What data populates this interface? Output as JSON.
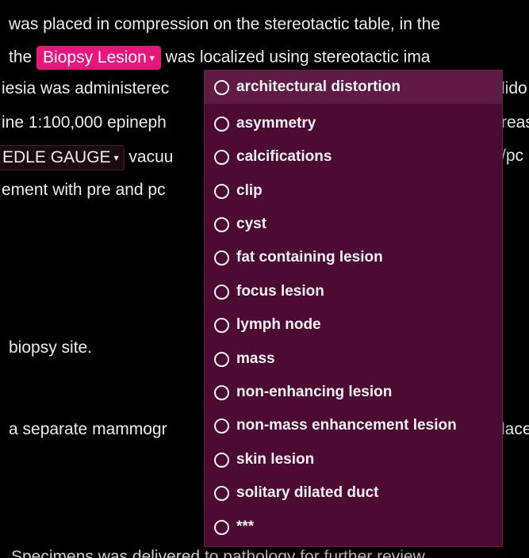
{
  "document": {
    "line1": "was placed in compression on the stereotactic table, in the",
    "line2_before": "the",
    "line2_dropdown": "Biopsy Lesion",
    "line2_after": "was localized using stereotactic ima",
    "line3": "iesia was administerec",
    "line3_right": "lido",
    "line4": "ine 1:100,000 epineph",
    "line4_right": "reas",
    "line5_dropdown": "EDLE GAUGE",
    "line5_after": "vacuu",
    "line5_right": "/pc",
    "line6": "ement with pre and pc",
    "line7": "biopsy site.",
    "line8": "a separate mammogr",
    "line8_right": "lace",
    "line9": "Specimens was delivered to pathology for further review."
  },
  "menu": {
    "items": [
      "architectural distortion",
      "asymmetry",
      "calcifications",
      "clip",
      "cyst",
      "fat containing lesion",
      "focus lesion",
      "lymph node",
      "mass",
      "non-enhancing lesion",
      "non-mass enhancement lesion",
      "skin lesion",
      "solitary dilated duct",
      "***"
    ],
    "highlighted_index": 0
  },
  "colors": {
    "accent": "#e8157b",
    "menu_background": "#4d0b33",
    "menu_highlight": "#5f1b43",
    "page_background": "#000000",
    "text": "#ececec"
  },
  "icons": {
    "dropdown_caret": "chevron-down-icon",
    "option_radio": "radio-unchecked-icon"
  }
}
